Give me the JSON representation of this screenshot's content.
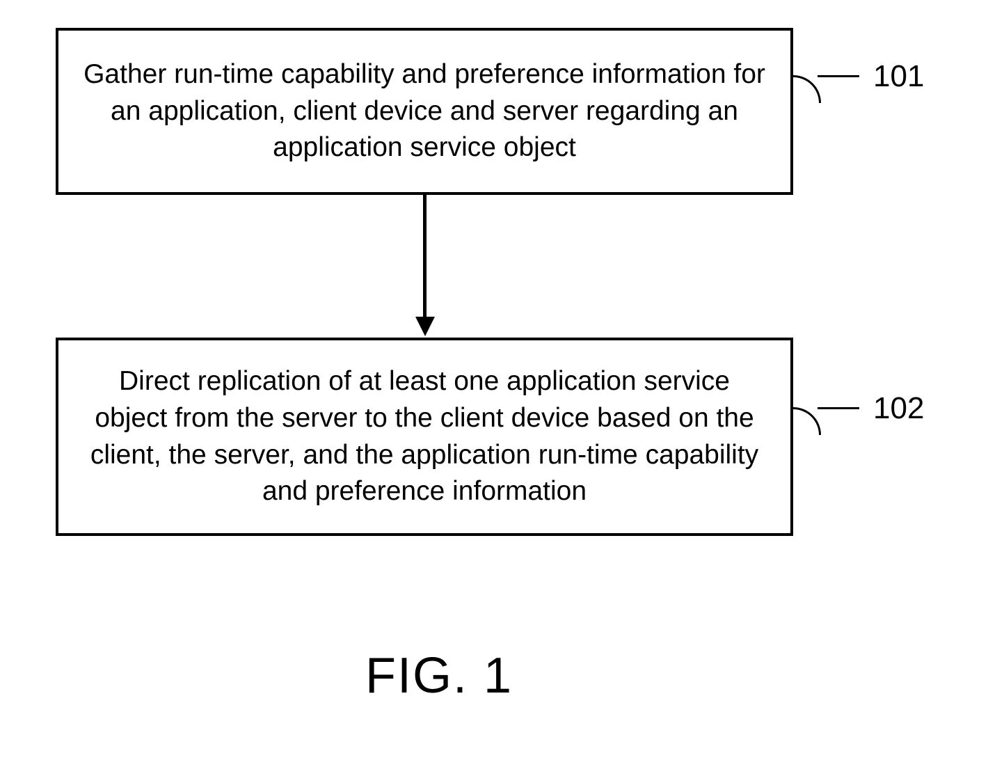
{
  "boxes": {
    "step1": {
      "text": "Gather run-time capability and preference information for an application, client device and server regarding an application service object",
      "label": "101"
    },
    "step2": {
      "text": "Direct replication of at least one application service object from the server to the client device based on the client, the server, and the application run-time capability and preference information",
      "label": "102"
    }
  },
  "figure_caption": "FIG. 1"
}
